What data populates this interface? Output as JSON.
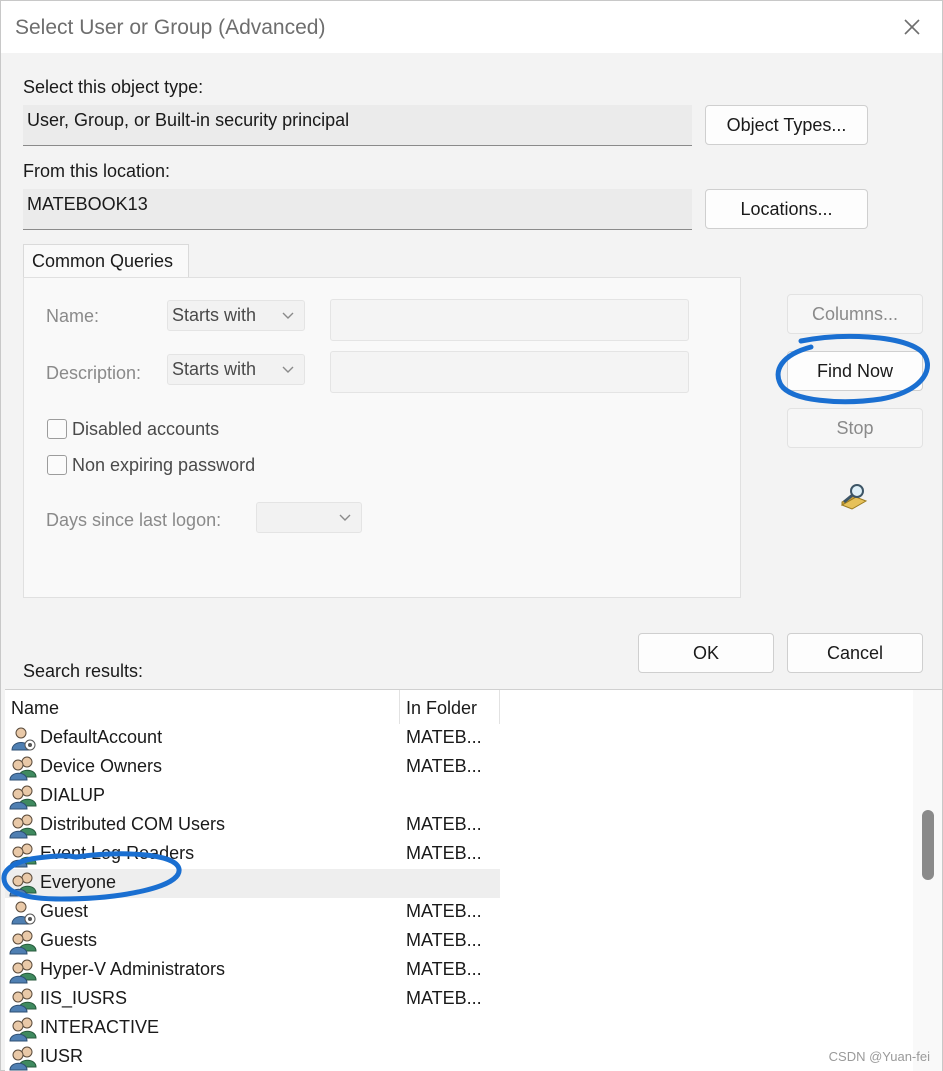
{
  "window": {
    "title": "Select User or Group (Advanced)"
  },
  "object_type": {
    "label": "Select this object type:",
    "value": "User, Group, or Built-in security principal",
    "button": "Object Types..."
  },
  "location": {
    "label": "From this location:",
    "value": "MATEBOOK13",
    "button": "Locations..."
  },
  "queries": {
    "tab": "Common Queries",
    "name_label": "Name:",
    "name_mode": "Starts with",
    "description_label": "Description:",
    "description_mode": "Starts with",
    "disabled_accounts": "Disabled accounts",
    "non_expiring": "Non expiring password",
    "days_label": "Days since last logon:"
  },
  "side_buttons": {
    "columns": "Columns...",
    "find_now": "Find Now",
    "stop": "Stop"
  },
  "dialog_buttons": {
    "ok": "OK",
    "cancel": "Cancel"
  },
  "results": {
    "label": "Search results:",
    "columns": [
      "Name",
      "In Folder"
    ],
    "rows": [
      {
        "name": "DefaultAccount",
        "folder": "MATEB...",
        "icon": "user-icon"
      },
      {
        "name": "Device Owners",
        "folder": "MATEB...",
        "icon": "group-icon"
      },
      {
        "name": "DIALUP",
        "folder": "",
        "icon": "group-icon"
      },
      {
        "name": "Distributed COM Users",
        "folder": "MATEB...",
        "icon": "group-icon"
      },
      {
        "name": "Event Log Readers",
        "folder": "MATEB...",
        "icon": "group-icon"
      },
      {
        "name": "Everyone",
        "folder": "",
        "icon": "group-icon"
      },
      {
        "name": "Guest",
        "folder": "MATEB...",
        "icon": "user-icon"
      },
      {
        "name": "Guests",
        "folder": "MATEB...",
        "icon": "group-icon"
      },
      {
        "name": "Hyper-V Administrators",
        "folder": "MATEB...",
        "icon": "group-icon"
      },
      {
        "name": "IIS_IUSRS",
        "folder": "MATEB...",
        "icon": "group-icon"
      },
      {
        "name": "INTERACTIVE",
        "folder": "",
        "icon": "group-icon"
      },
      {
        "name": "IUSR",
        "folder": "",
        "icon": "group-icon"
      }
    ],
    "selected_index": 5
  },
  "watermark": "CSDN @Yuan-fei",
  "colors": {
    "annotation": "#1a6fd1",
    "window_bg": "#f3f3f3"
  }
}
